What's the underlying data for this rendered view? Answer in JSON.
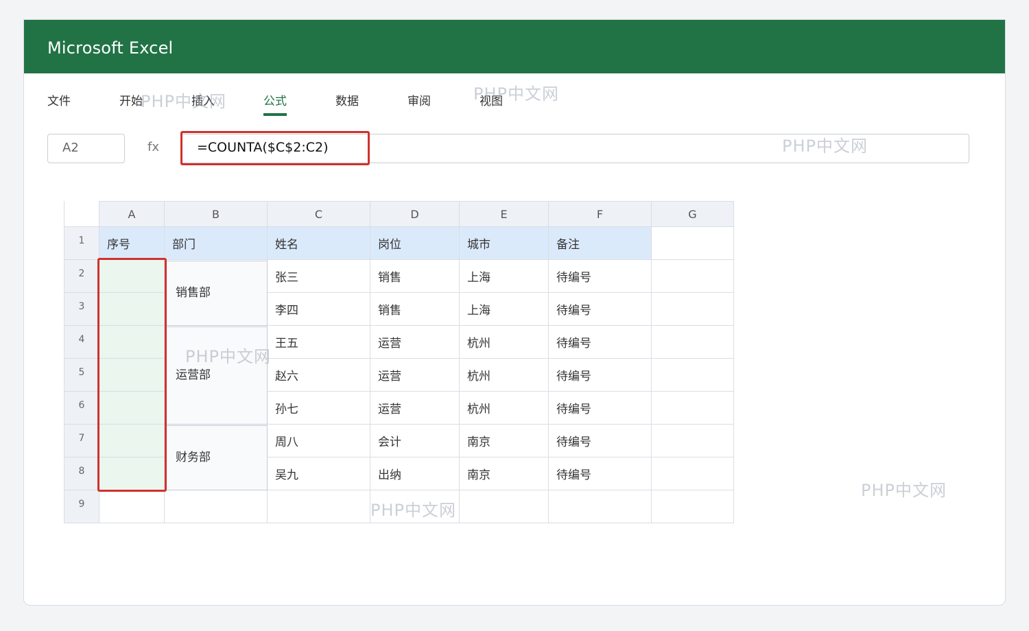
{
  "app": {
    "title": "Microsoft Excel"
  },
  "ribbon": {
    "tabs": [
      {
        "label": "文件"
      },
      {
        "label": "开始"
      },
      {
        "label": "插入"
      },
      {
        "label": "公式",
        "active": true
      },
      {
        "label": "数据"
      },
      {
        "label": "审阅"
      },
      {
        "label": "视图"
      }
    ]
  },
  "formula": {
    "name_box": "A2",
    "fx_label": "fx",
    "value": "=COUNTA($C$2:C2)"
  },
  "sheet": {
    "columns": [
      "A",
      "B",
      "C",
      "D",
      "E",
      "F",
      "G"
    ],
    "rows": [
      "1",
      "2",
      "3",
      "4",
      "5",
      "6",
      "7",
      "8",
      "9"
    ],
    "header_row": [
      "序号",
      "部门",
      "姓名",
      "岗位",
      "城市",
      "备注",
      ""
    ],
    "merged_departments": [
      {
        "label": "销售部",
        "rows": "2-3"
      },
      {
        "label": "运营部",
        "rows": "4-6"
      },
      {
        "label": "财务部",
        "rows": "7-8"
      }
    ],
    "data_rows": [
      [
        "张三",
        "销售",
        "上海",
        "待编号"
      ],
      [
        "李四",
        "销售",
        "上海",
        "待编号"
      ],
      [
        "王五",
        "运营",
        "杭州",
        "待编号"
      ],
      [
        "赵六",
        "运营",
        "杭州",
        "待编号"
      ],
      [
        "孙七",
        "运营",
        "杭州",
        "待编号"
      ],
      [
        "周八",
        "会计",
        "南京",
        "待编号"
      ],
      [
        "吴九",
        "出纳",
        "南京",
        "待编号"
      ]
    ]
  },
  "watermark": "PHP中文网",
  "colors": {
    "brand_green": "#217346",
    "highlight_red": "#d0312d",
    "header_fill": "#dbeafb",
    "selection_fill": "#eaf6ee"
  }
}
